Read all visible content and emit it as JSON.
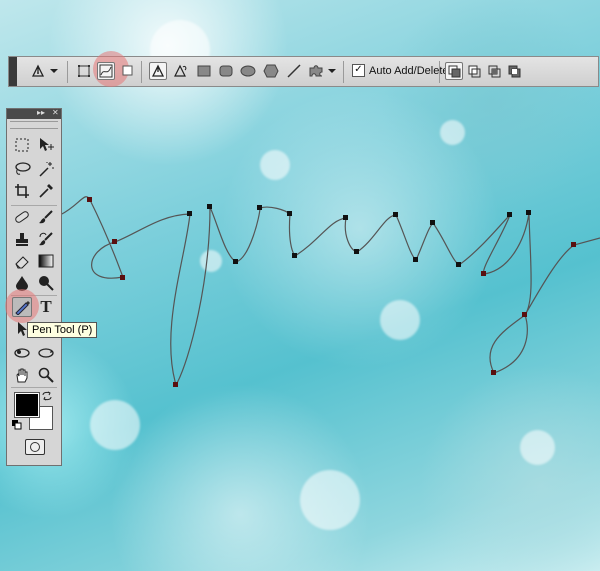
{
  "options_bar": {
    "auto_add_delete_label": "Auto Add/Delete",
    "auto_add_delete_checked": true
  },
  "tools_panel": {
    "header_glyph": "▸▸",
    "close_glyph": "✕",
    "tooltip_text": "Pen Tool (P)",
    "type_tool_glyph": "T",
    "foreground_color": "#000000",
    "background_color": "#ffffff"
  },
  "colors": {
    "highlight": "#e47878",
    "path_stroke": "#555555",
    "anchor": "#111111",
    "anchor_selected": "#5a1010"
  }
}
